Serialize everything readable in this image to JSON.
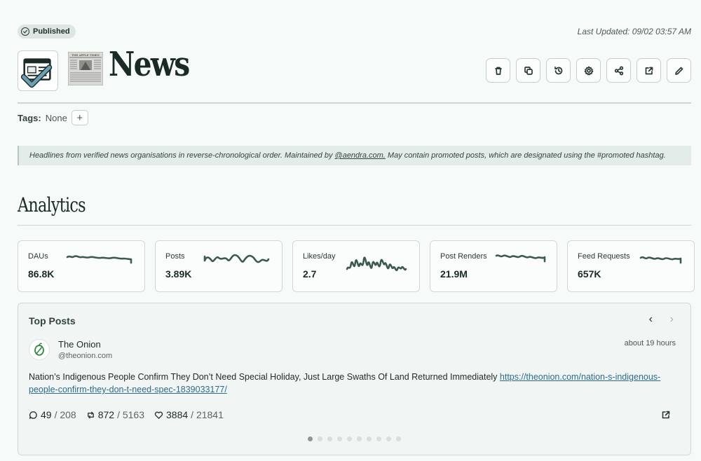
{
  "status": {
    "label": "Published"
  },
  "last_updated": "Last Updated: 09/02 03:57 AM",
  "feed": {
    "title": "News",
    "paper_masthead": "THE APPLE TIMES"
  },
  "actions": [
    {
      "name": "delete-button",
      "icon": "trash-icon"
    },
    {
      "name": "duplicate-button",
      "icon": "copy-icon"
    },
    {
      "name": "history-button",
      "icon": "history-icon"
    },
    {
      "name": "settings-button",
      "icon": "gear-icon"
    },
    {
      "name": "share-button",
      "icon": "share-icon"
    },
    {
      "name": "open-external-button",
      "icon": "external-link-icon"
    },
    {
      "name": "edit-button",
      "icon": "pencil-icon"
    }
  ],
  "tags": {
    "label": "Tags:",
    "value": "None",
    "add": "+"
  },
  "description": {
    "before": "Headlines from verified news organisations in reverse-chronological order. Maintained by ",
    "link": "@aendra.com.",
    "after": " May contain promoted posts, which are designated using the #promoted hashtag."
  },
  "analytics": {
    "title": "Analytics",
    "stats": [
      {
        "label": "DAUs",
        "value": "86.8K"
      },
      {
        "label": "Posts",
        "value": "3.89K"
      },
      {
        "label": "Likes/day",
        "value": "2.7"
      },
      {
        "label": "Post Renders",
        "value": "21.9M"
      },
      {
        "label": "Feed Requests",
        "value": "657K"
      }
    ],
    "sparkline_color": "#3d5a50"
  },
  "top_posts": {
    "title": "Top Posts",
    "prev": "‹",
    "next": "›",
    "post": {
      "author": "The Onion",
      "handle": "@theonion.com",
      "time": "about 19 hours",
      "text": "Nation’s Indigenous People Confirm They Don’t Need Special Holiday, Just Large Swaths Of Land Returned Immediately ",
      "url": "https://theonion.com/nation-s-indigenous-people-confirm-they-don-t-need-spec-1839033177/",
      "replies": "49",
      "replies_total": "/ 208",
      "reposts": "872",
      "reposts_total": "/ 5163",
      "likes": "3884",
      "likes_total": "/ 21841"
    },
    "page_count": 10,
    "active_page": 1
  }
}
